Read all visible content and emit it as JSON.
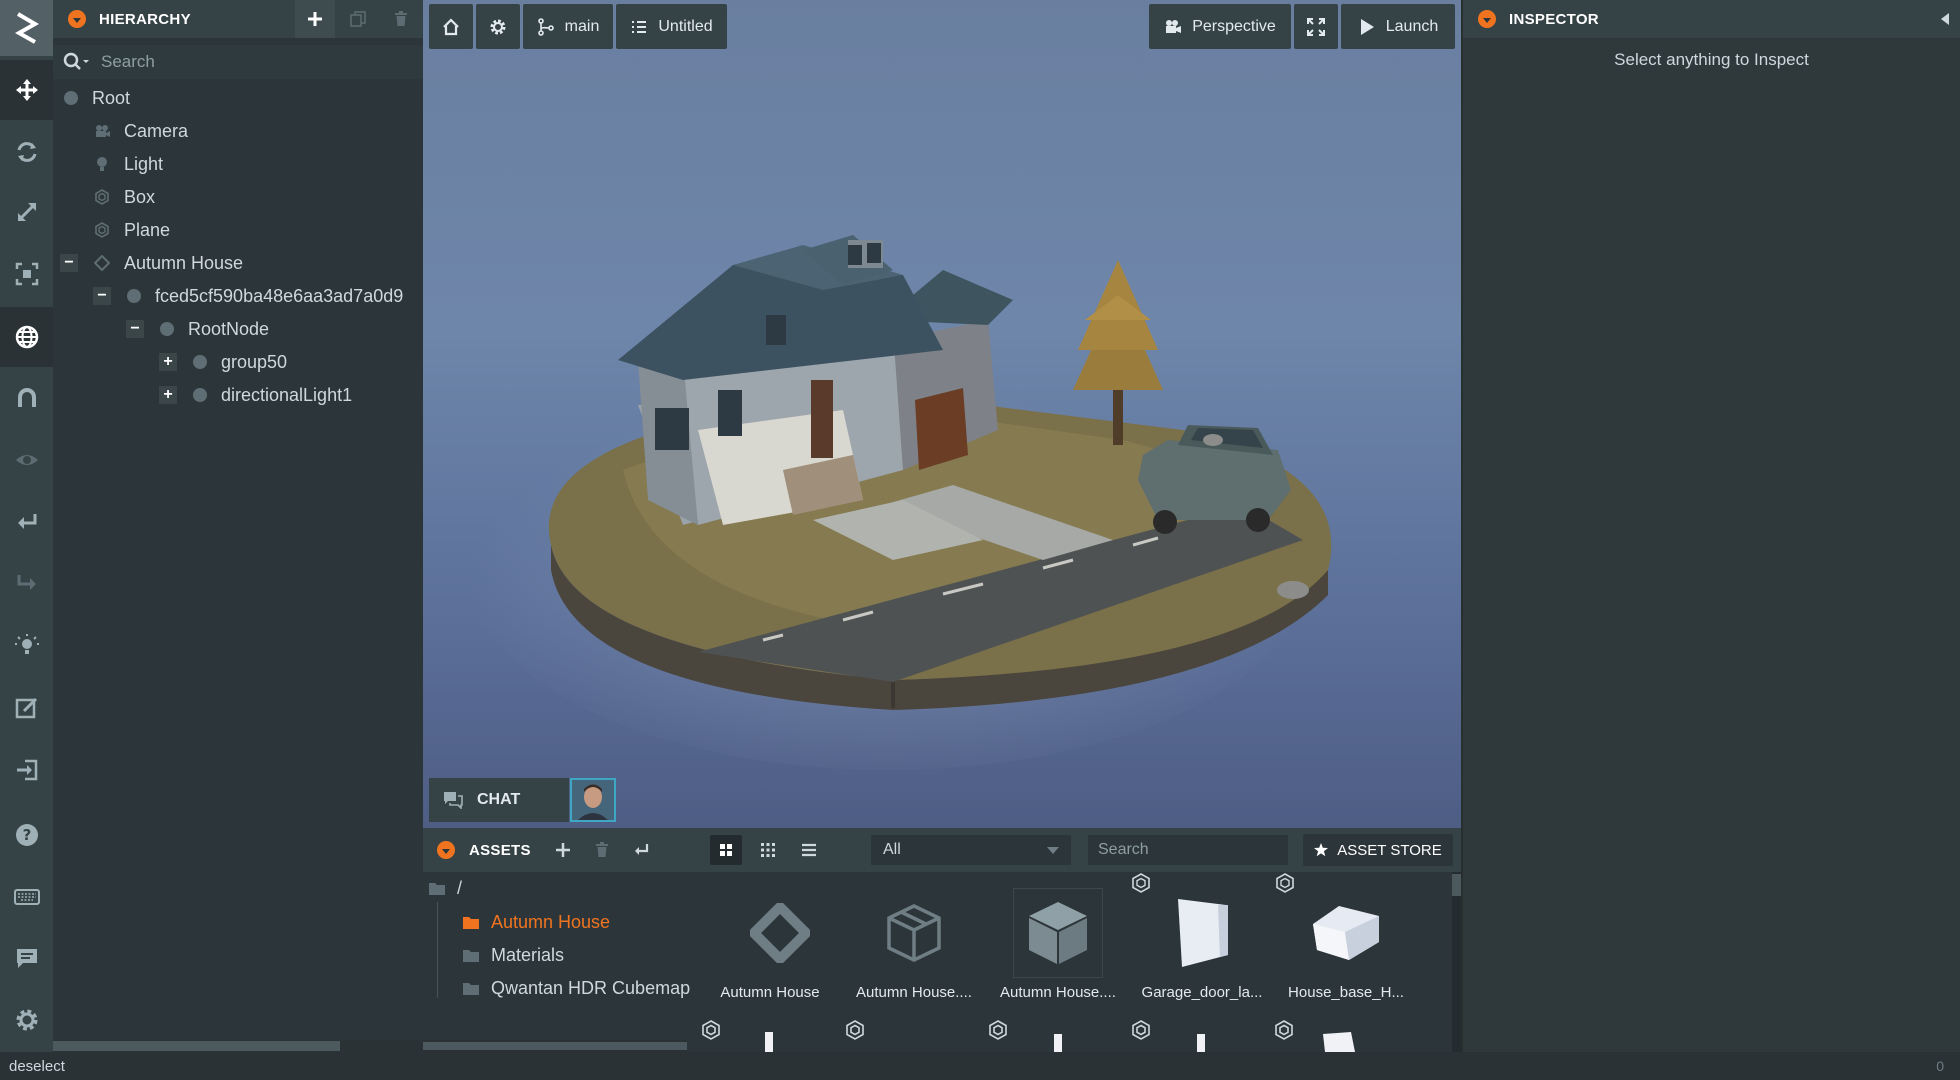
{
  "toolbar": {
    "tools": [
      "logo-icon",
      "move-icon",
      "rotate-icon",
      "scale-icon",
      "resize-icon",
      "world-icon",
      "magnet-icon",
      "eye-icon",
      "undo-icon",
      "redo-icon",
      "light-icon",
      "edit-icon",
      "publish-icon",
      "help-icon",
      "keyboard-icon",
      "feedback-icon",
      "settings-icon"
    ]
  },
  "hierarchy": {
    "title": "HIERARCHY",
    "search_placeholder": "Search",
    "items": [
      {
        "label": "Root",
        "icon": "entity-dot"
      },
      {
        "label": "Camera",
        "icon": "camera-icon"
      },
      {
        "label": "Light",
        "icon": "light-icon"
      },
      {
        "label": "Box",
        "icon": "model-icon"
      },
      {
        "label": "Plane",
        "icon": "model-icon"
      },
      {
        "label": "Autumn House",
        "icon": "template-icon",
        "toggle": "−"
      },
      {
        "label": "fced5cf590ba48e6aa3ad7a0d9",
        "icon": "entity-dot",
        "toggle": "−"
      },
      {
        "label": "RootNode",
        "icon": "entity-dot",
        "toggle": "−"
      },
      {
        "label": "group50",
        "icon": "entity-dot",
        "toggle": "+"
      },
      {
        "label": "directionalLight1",
        "icon": "entity-dot",
        "toggle": "+"
      }
    ]
  },
  "viewport": {
    "home_icon": "home-icon",
    "settings_icon": "gear-icon",
    "branch_label": "main",
    "scene_label": "Untitled",
    "camera_label": "Perspective",
    "launch_label": "Launch",
    "chat_label": "CHAT"
  },
  "assets": {
    "title": "ASSETS",
    "filter_value": "All",
    "search_placeholder": "Search",
    "store_label": "ASSET STORE",
    "root_folder": "/",
    "folders": [
      {
        "label": "Autumn House",
        "selected": true
      },
      {
        "label": "Materials",
        "selected": false
      },
      {
        "label": "Qwantan HDR Cubemap",
        "selected": false
      }
    ],
    "items": [
      {
        "name": "Autumn House",
        "kind": "template-icon"
      },
      {
        "name": "Autumn House....",
        "kind": "container-icon"
      },
      {
        "name": "Autumn House....",
        "kind": "model-icon"
      },
      {
        "name": "Garage_door_la...",
        "kind": "mesh-thumbnail"
      },
      {
        "name": "House_base_H...",
        "kind": "mesh-thumbnail"
      }
    ]
  },
  "inspector": {
    "title": "INSPECTOR",
    "empty_message": "Select anything to Inspect"
  },
  "status": {
    "message": "deselect",
    "right_value": "0"
  },
  "colors": {
    "accent": "#f0741f",
    "panel": "#364346",
    "background": "#2c3539"
  }
}
